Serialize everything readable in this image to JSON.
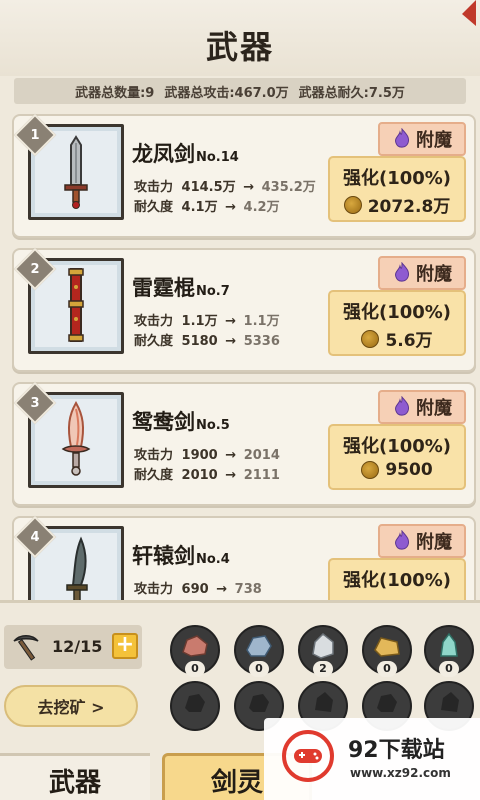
{
  "title": "武器",
  "summary": {
    "count": "武器总数量:9",
    "attack": "武器总攻击:467.0万",
    "durability": "武器总耐久:7.5万"
  },
  "weapons": [
    {
      "rank": "1",
      "name": "龙凤剑",
      "no": "No.14",
      "icon": "sword-icon",
      "atk_label": "攻击力",
      "atk_cur": "414.5万",
      "atk_next": "435.2万",
      "dur_label": "耐久度",
      "dur_cur": "4.1万",
      "dur_next": "4.2万",
      "enchant_label": "附魔",
      "upgrade_label": "强化(100%)",
      "cost": "2072.8万"
    },
    {
      "rank": "2",
      "name": "雷霆棍",
      "no": "No.7",
      "icon": "staff-icon",
      "atk_label": "攻击力",
      "atk_cur": "1.1万",
      "atk_next": "1.1万",
      "dur_label": "耐久度",
      "dur_cur": "5180",
      "dur_next": "5336",
      "enchant_label": "附魔",
      "upgrade_label": "强化(100%)",
      "cost": "5.6万"
    },
    {
      "rank": "3",
      "name": "鸳鸯剑",
      "no": "No.5",
      "icon": "flame-sword-icon",
      "atk_label": "攻击力",
      "atk_cur": "1900",
      "atk_next": "2014",
      "dur_label": "耐久度",
      "dur_cur": "2010",
      "dur_next": "2111",
      "enchant_label": "附魔",
      "upgrade_label": "强化(100%)",
      "cost": "9500"
    },
    {
      "rank": "4",
      "name": "轩辕剑",
      "no": "No.4",
      "icon": "sabre-icon",
      "atk_label": "攻击力",
      "atk_cur": "690",
      "atk_next": "738",
      "dur_label": "耐久度",
      "dur_cur": "",
      "dur_next": "",
      "enchant_label": "附魔",
      "upgrade_label": "强化(100%)",
      "cost": ""
    }
  ],
  "pickaxe": {
    "count": "12/15",
    "plus": "+",
    "icon": "pickaxe-icon"
  },
  "mine_button": "去挖矿 >",
  "ores": [
    {
      "icon": "red-ore-icon",
      "count": "0"
    },
    {
      "icon": "blue-ore-icon",
      "count": "0"
    },
    {
      "icon": "silver-ore-icon",
      "count": "2"
    },
    {
      "icon": "gold-ingot-icon",
      "count": "0"
    },
    {
      "icon": "crystal-icon",
      "count": "0"
    }
  ],
  "tabs": {
    "weapons": "武器",
    "spirit": "剑灵"
  },
  "watermark": {
    "title": "92下载站",
    "url": "www.xz92.com"
  },
  "colors": {
    "accent": "#f9e2a8",
    "enchant": "#f6d0b6",
    "background": "#efe9dc"
  }
}
